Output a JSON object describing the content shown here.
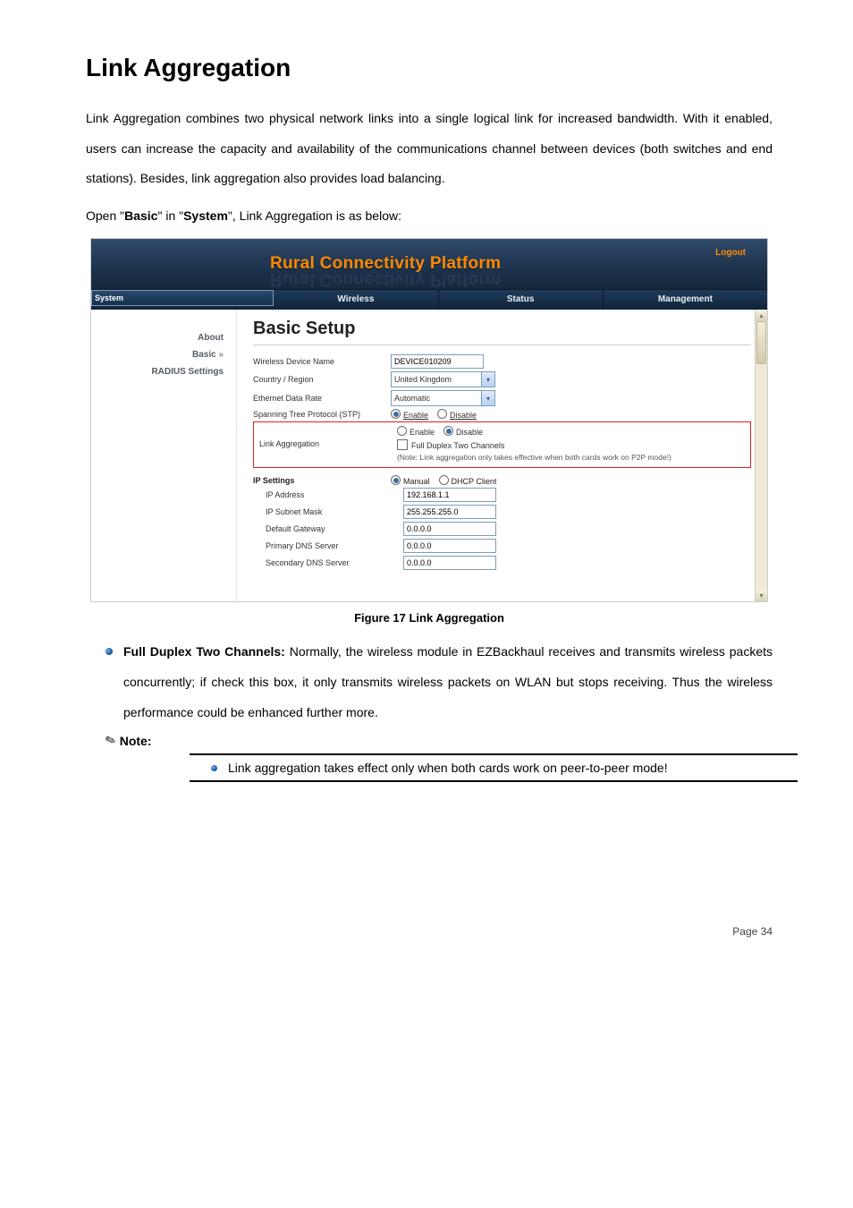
{
  "heading": "Link Aggregation",
  "para1": "Link Aggregation combines two physical network links into a single logical link for increased bandwidth. With it enabled, users can increase the capacity and availability of the communications channel between devices (both switches and end stations). Besides, link aggregation also provides load balancing.",
  "para2_pre": "Open \"",
  "para2_b1": "Basic",
  "para2_mid": "\" in \"",
  "para2_b2": "System",
  "para2_post": "\", Link Aggregation is as below:",
  "ui": {
    "brand": "Rural Connectivity Platform",
    "logout": "Logout",
    "tabs": {
      "t0": "System",
      "t1": "Wireless",
      "t2": "Status",
      "t3": "Management"
    },
    "side": {
      "about": "About",
      "basic": "Basic",
      "chev": "»",
      "radius": "RADIUS Settings"
    },
    "panel_title": "Basic Setup",
    "rows": {
      "devname_lbl": "Wireless Device Name",
      "devname_val": "DEVICE010209",
      "country_lbl": "Country / Region",
      "country_val": "United Kingdom",
      "eth_lbl": "Ethernet Data Rate",
      "eth_val": "Automatic",
      "stp_lbl": "Spanning Tree Protocol (STP)",
      "stp_enable": "Enable",
      "stp_disable": "Disable",
      "la_lbl": "Link Aggregation",
      "la_enable": "Enable",
      "la_disable": "Disable",
      "la_full": "Full Duplex Two Channels",
      "la_note": "(Note: Link aggregation only takes effective when both cards work on P2P mode!)",
      "ipsect": "IP Settings",
      "ip_manual": "Manual",
      "ip_dhcp": "DHCP Client",
      "ipaddr_lbl": "IP Address",
      "ipaddr_val": "192.168.1.1",
      "mask_lbl": "IP Subnet Mask",
      "mask_val": "255.255.255.0",
      "gw_lbl": "Default Gateway",
      "gw_val": "0.0.0.0",
      "pdns_lbl": "Primary DNS Server",
      "pdns_val": "0.0.0.0",
      "sdns_lbl": "Secondary DNS Server",
      "sdns_val": "0.0.0.0"
    }
  },
  "caption": "Figure 17 Link Aggregation",
  "bullet1_strong": "Full Duplex Two Channels:",
  "bullet1_rest": " Normally, the wireless module in EZBackhaul receives and transmits wireless packets concurrently; if check this box, it only transmits wireless packets on WLAN but stops receiving. Thus the wireless performance could be enhanced further more.",
  "note_label": "Note:",
  "sub_bullet": "Link aggregation takes effect only when both cards work on peer-to-peer mode!",
  "page_num": "Page 34"
}
